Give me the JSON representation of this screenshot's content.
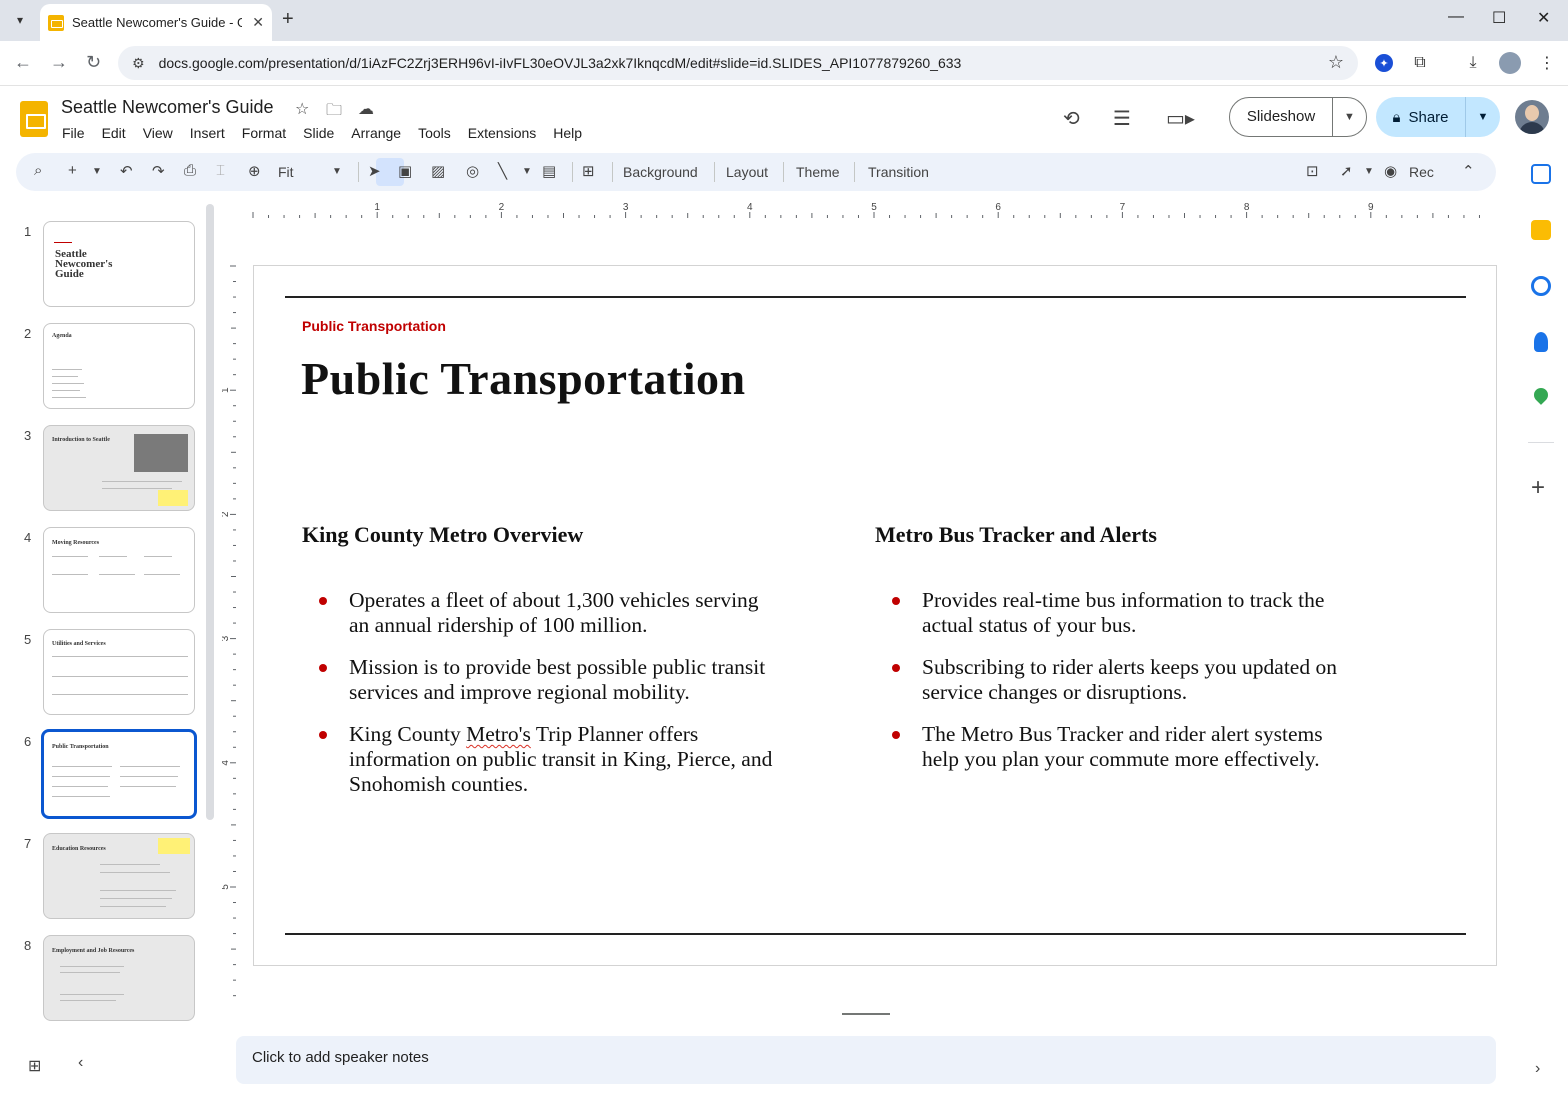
{
  "browser": {
    "tab_title": "Seattle Newcomer's Guide - Goo",
    "url": "docs.google.com/presentation/d/1iAzFC2Zrj3ERH96vI-iIvFL30eOVJL3a2xk7IknqcdM/edit#slide=id.SLIDES_API1077879260_633"
  },
  "doc": {
    "title": "Seattle Newcomer's Guide",
    "menu": [
      "File",
      "Edit",
      "View",
      "Insert",
      "Format",
      "Slide",
      "Arrange",
      "Tools",
      "Extensions",
      "Help"
    ],
    "slideshow_label": "Slideshow",
    "share_label": "Share"
  },
  "toolbar": {
    "zoom_label": "Fit",
    "background_label": "Background",
    "layout_label": "Layout",
    "theme_label": "Theme",
    "transition_label": "Transition",
    "rec_label": "Rec"
  },
  "ruler": {
    "h_labels": [
      "1",
      "2",
      "3",
      "4",
      "5",
      "6",
      "7",
      "8",
      "9"
    ],
    "v_labels": [
      "1",
      "2",
      "3",
      "4",
      "5"
    ]
  },
  "filmstrip": {
    "numbers": [
      "1",
      "2",
      "3",
      "4",
      "5",
      "6",
      "7",
      "8"
    ],
    "selected_index": 6,
    "thumb_titles": [
      "Seattle Newcomer's Guide",
      "Agenda",
      "Introduction to Seattle",
      "Moving Resources",
      "Utilities and Services",
      "Public Transportation",
      "Education Resources",
      "Employment and Job Resources"
    ]
  },
  "slide": {
    "kicker": "Public Transportation",
    "title": "Public Transportation",
    "left_heading": "King County Metro Overview",
    "right_heading": "Metro Bus Tracker and Alerts",
    "left_bullets": [
      "Operates a fleet of about 1,300 vehicles serving an annual ridership of 100 million.",
      "Mission is to provide best possible public transit services and improve regional mobility.",
      "King County Metro's Trip Planner offers information on public transit in King, Pierce, and Snohomish counties."
    ],
    "left_bullet3_pre": "King County ",
    "left_bullet3_flag": "Metro's",
    "left_bullet3_post": " Trip Planner offers information on public transit in King, Pierce, and Snohomish counties.",
    "right_bullets": [
      "Provides real-time bus information to track the actual status of your bus.",
      "Subscribing to rider alerts keeps you updated on service changes or disruptions.",
      "The Metro Bus Tracker and rider alert systems help you plan your commute more effectively."
    ]
  },
  "notes": {
    "placeholder": "Click to add speaker notes"
  },
  "colors": {
    "accent_red": "#c00000",
    "selected_blue": "#0b57d0",
    "share_bg": "#c2e7ff",
    "toolbar_bg": "#edf2fa"
  }
}
